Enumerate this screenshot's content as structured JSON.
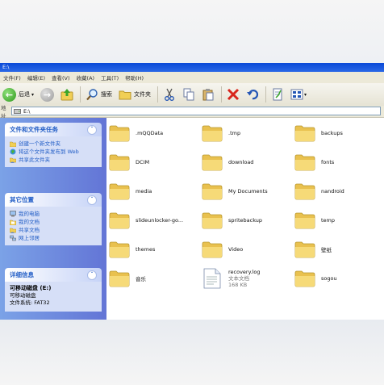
{
  "window": {
    "title": "E:\\"
  },
  "menu": [
    "文件(F)",
    "编辑(E)",
    "查看(V)",
    "收藏(A)",
    "工具(T)",
    "帮助(H)"
  ],
  "toolbar": {
    "back_label": "后退",
    "search_label": "搜索",
    "folders_label": "文件夹"
  },
  "address": {
    "label": "地址",
    "value": "E:\\"
  },
  "sidebar": {
    "tasks": {
      "title": "文件和文件夹任务",
      "items": [
        {
          "icon": "new-folder-icon",
          "label": "创建一个新文件夹"
        },
        {
          "icon": "web-publish-icon",
          "label": "将这个文件夹发布到 Web"
        },
        {
          "icon": "share-folder-icon",
          "label": "共享此文件夹"
        }
      ]
    },
    "places": {
      "title": "其它位置",
      "items": [
        {
          "icon": "my-computer-icon",
          "label": "我的电脑"
        },
        {
          "icon": "my-documents-icon",
          "label": "我的文档"
        },
        {
          "icon": "shared-docs-icon",
          "label": "共享文档"
        },
        {
          "icon": "network-icon",
          "label": "网上邻居"
        }
      ]
    },
    "details": {
      "title": "详细信息",
      "name": "可移动磁盘 (E:)",
      "type": "可移动磁盘",
      "fs": "文件系统: FAT32"
    }
  },
  "files": [
    {
      "name": ".mQQData"
    },
    {
      "name": ".tmp"
    },
    {
      "name": "backups"
    },
    {
      "name": "DCIM"
    },
    {
      "name": "download"
    },
    {
      "name": "fonts"
    },
    {
      "name": "media"
    },
    {
      "name": "My Documents"
    },
    {
      "name": "nandroid"
    },
    {
      "name": "slideunlocker-go..."
    },
    {
      "name": "spritebackup"
    },
    {
      "name": "temp"
    },
    {
      "name": "themes"
    },
    {
      "name": "Video"
    },
    {
      "name": "壁纸"
    },
    {
      "name": "音乐"
    },
    {
      "name": "recovery.log",
      "type": "文本文档",
      "size": "168 KB",
      "is_file": true
    },
    {
      "name": "sogou"
    }
  ],
  "colors": {
    "folder": "#f5d66c",
    "sidebar": "#6f8ee0",
    "accent": "#215dc6"
  }
}
